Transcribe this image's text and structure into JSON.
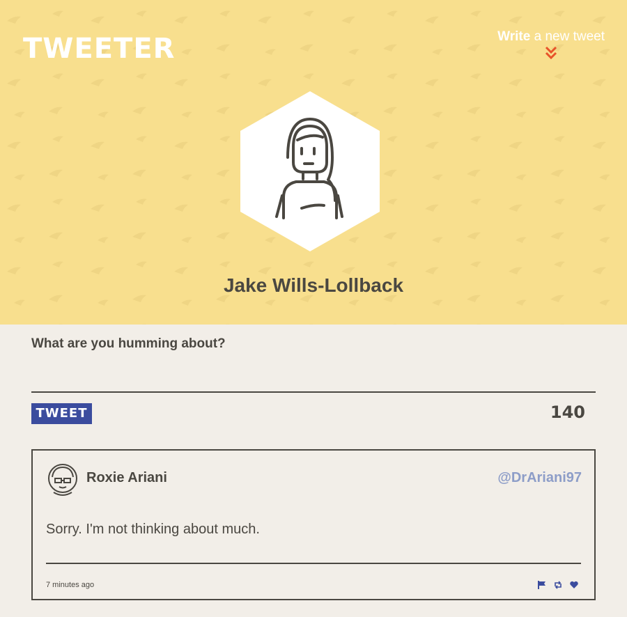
{
  "nav": {
    "brand": "TWEETER",
    "compose_strong": "Write",
    "compose_rest": " a new tweet"
  },
  "profile": {
    "name": "Jake Wills-Lollback"
  },
  "compose": {
    "label": "What are you humming about?",
    "button_label": "TWEET",
    "counter": "140"
  },
  "tweets": [
    {
      "author": "Roxie Ariani",
      "handle": "@DrAriani97",
      "content": "Sorry. I'm not thinking about much.",
      "time": "7 minutes ago",
      "actions": [
        "flag-icon",
        "retweet-icon",
        "heart-icon"
      ]
    }
  ],
  "colors": {
    "header_bg": "#f8df8e",
    "page_bg": "#f2eee8",
    "accent": "#3b4c9e",
    "handle": "#8d9dc8",
    "chevron": "#e8532a"
  }
}
